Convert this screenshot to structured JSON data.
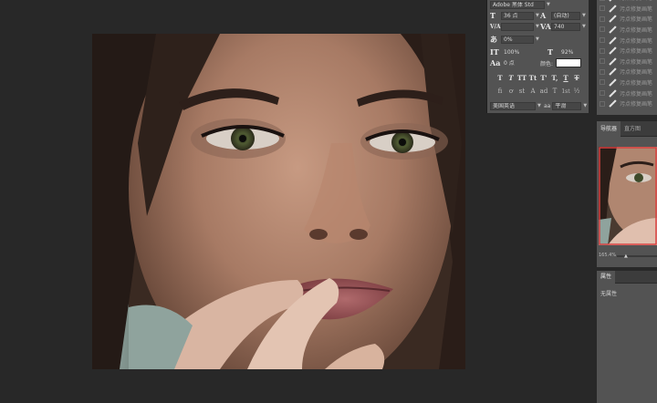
{
  "character_panel": {
    "font_family": "Adobe 黑体 Std",
    "font_size": "36 点",
    "leading": "(自动)",
    "kerning": "",
    "tracking": "740",
    "tsume": "0%",
    "vertical_scale": "100%",
    "horizontal_scale": "92%",
    "baseline_shift": "0 点",
    "color_label": "颜色:",
    "color_value": "#ffffff",
    "style_buttons": [
      "T",
      "T",
      "TT",
      "Tt",
      "T'",
      "T,",
      "T",
      "T"
    ],
    "opentype_buttons": [
      "fi",
      "ơ",
      "st",
      "A",
      "ad",
      "T",
      "1st",
      "½"
    ],
    "language": "美国英语",
    "antialias_icon": "aa",
    "antialias": "平滑"
  },
  "list_panel": {
    "items": [
      "污点修复画笔",
      "污点修复画笔",
      "污点修复画笔",
      "污点修复画笔",
      "污点修复画笔",
      "污点修复画笔",
      "污点修复画笔",
      "污点修复画笔",
      "污点修复画笔",
      "污点修复画笔",
      "污点修复画笔"
    ]
  },
  "navigator": {
    "tabs": [
      "导航器",
      "直方图"
    ],
    "zoom": "165.4%"
  },
  "properties": {
    "tab": "属性",
    "content": "无属性"
  },
  "colors": {
    "panel": "#535353",
    "background": "#282828",
    "accent_red": "#d94040"
  }
}
